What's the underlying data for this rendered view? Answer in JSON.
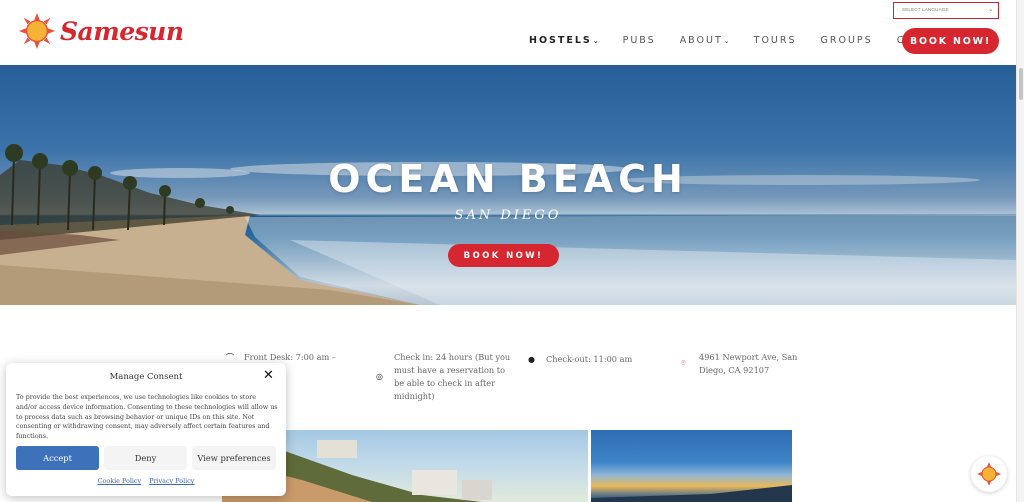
{
  "brand": {
    "name": "Samesun",
    "logo_icon": "sun-logo-icon",
    "colors": {
      "accent": "#d6262f",
      "accept": "#3d72bb",
      "link": "#3d66a8"
    }
  },
  "language_selector": {
    "selected": "SELECT LANGUAGE"
  },
  "nav": {
    "items": [
      {
        "label": "HOSTELS",
        "has_dropdown": true,
        "active": true
      },
      {
        "label": "PUBS",
        "has_dropdown": false
      },
      {
        "label": "ABOUT",
        "has_dropdown": true
      },
      {
        "label": "TOURS",
        "has_dropdown": false
      },
      {
        "label": "GROUPS",
        "has_dropdown": false
      },
      {
        "label": "CONTACT",
        "has_dropdown": false
      }
    ],
    "book_label": "BOOK NOW!",
    "caret": "⌄"
  },
  "hero": {
    "title": "OCEAN BEACH",
    "subtitle": "SAN DIEGO",
    "book_label": "BOOK NOW!"
  },
  "info": [
    {
      "icon": "desk-bell-icon",
      "glyph": "⌒",
      "text": "Front Desk: 7:00 am –"
    },
    {
      "icon": "clock-outline-icon",
      "glyph": "◎",
      "text": "Check in: 24 hours (But you must have a reservation to be able to check in after midnight)"
    },
    {
      "icon": "clock-solid-icon",
      "glyph": "●",
      "text": "Check-out: 11:00 am"
    },
    {
      "icon": "map-pin-icon",
      "glyph": "⌾",
      "text": "4961 Newport Ave, San Diego, CA 92107"
    }
  ],
  "consent": {
    "title": "Manage Consent",
    "close_glyph": "✕",
    "body": "To provide the best experiences, we use technologies like cookies to store and/or access device information. Consenting to these technologies will allow us to process data such as browsing behavior or unique IDs on this site. Not consenting or withdrawing consent, may adversely affect certain features and functions.",
    "accept_label": "Accept",
    "deny_label": "Deny",
    "preferences_label": "View preferences",
    "links": [
      "Cookie Policy",
      "Privacy Policy"
    ]
  }
}
